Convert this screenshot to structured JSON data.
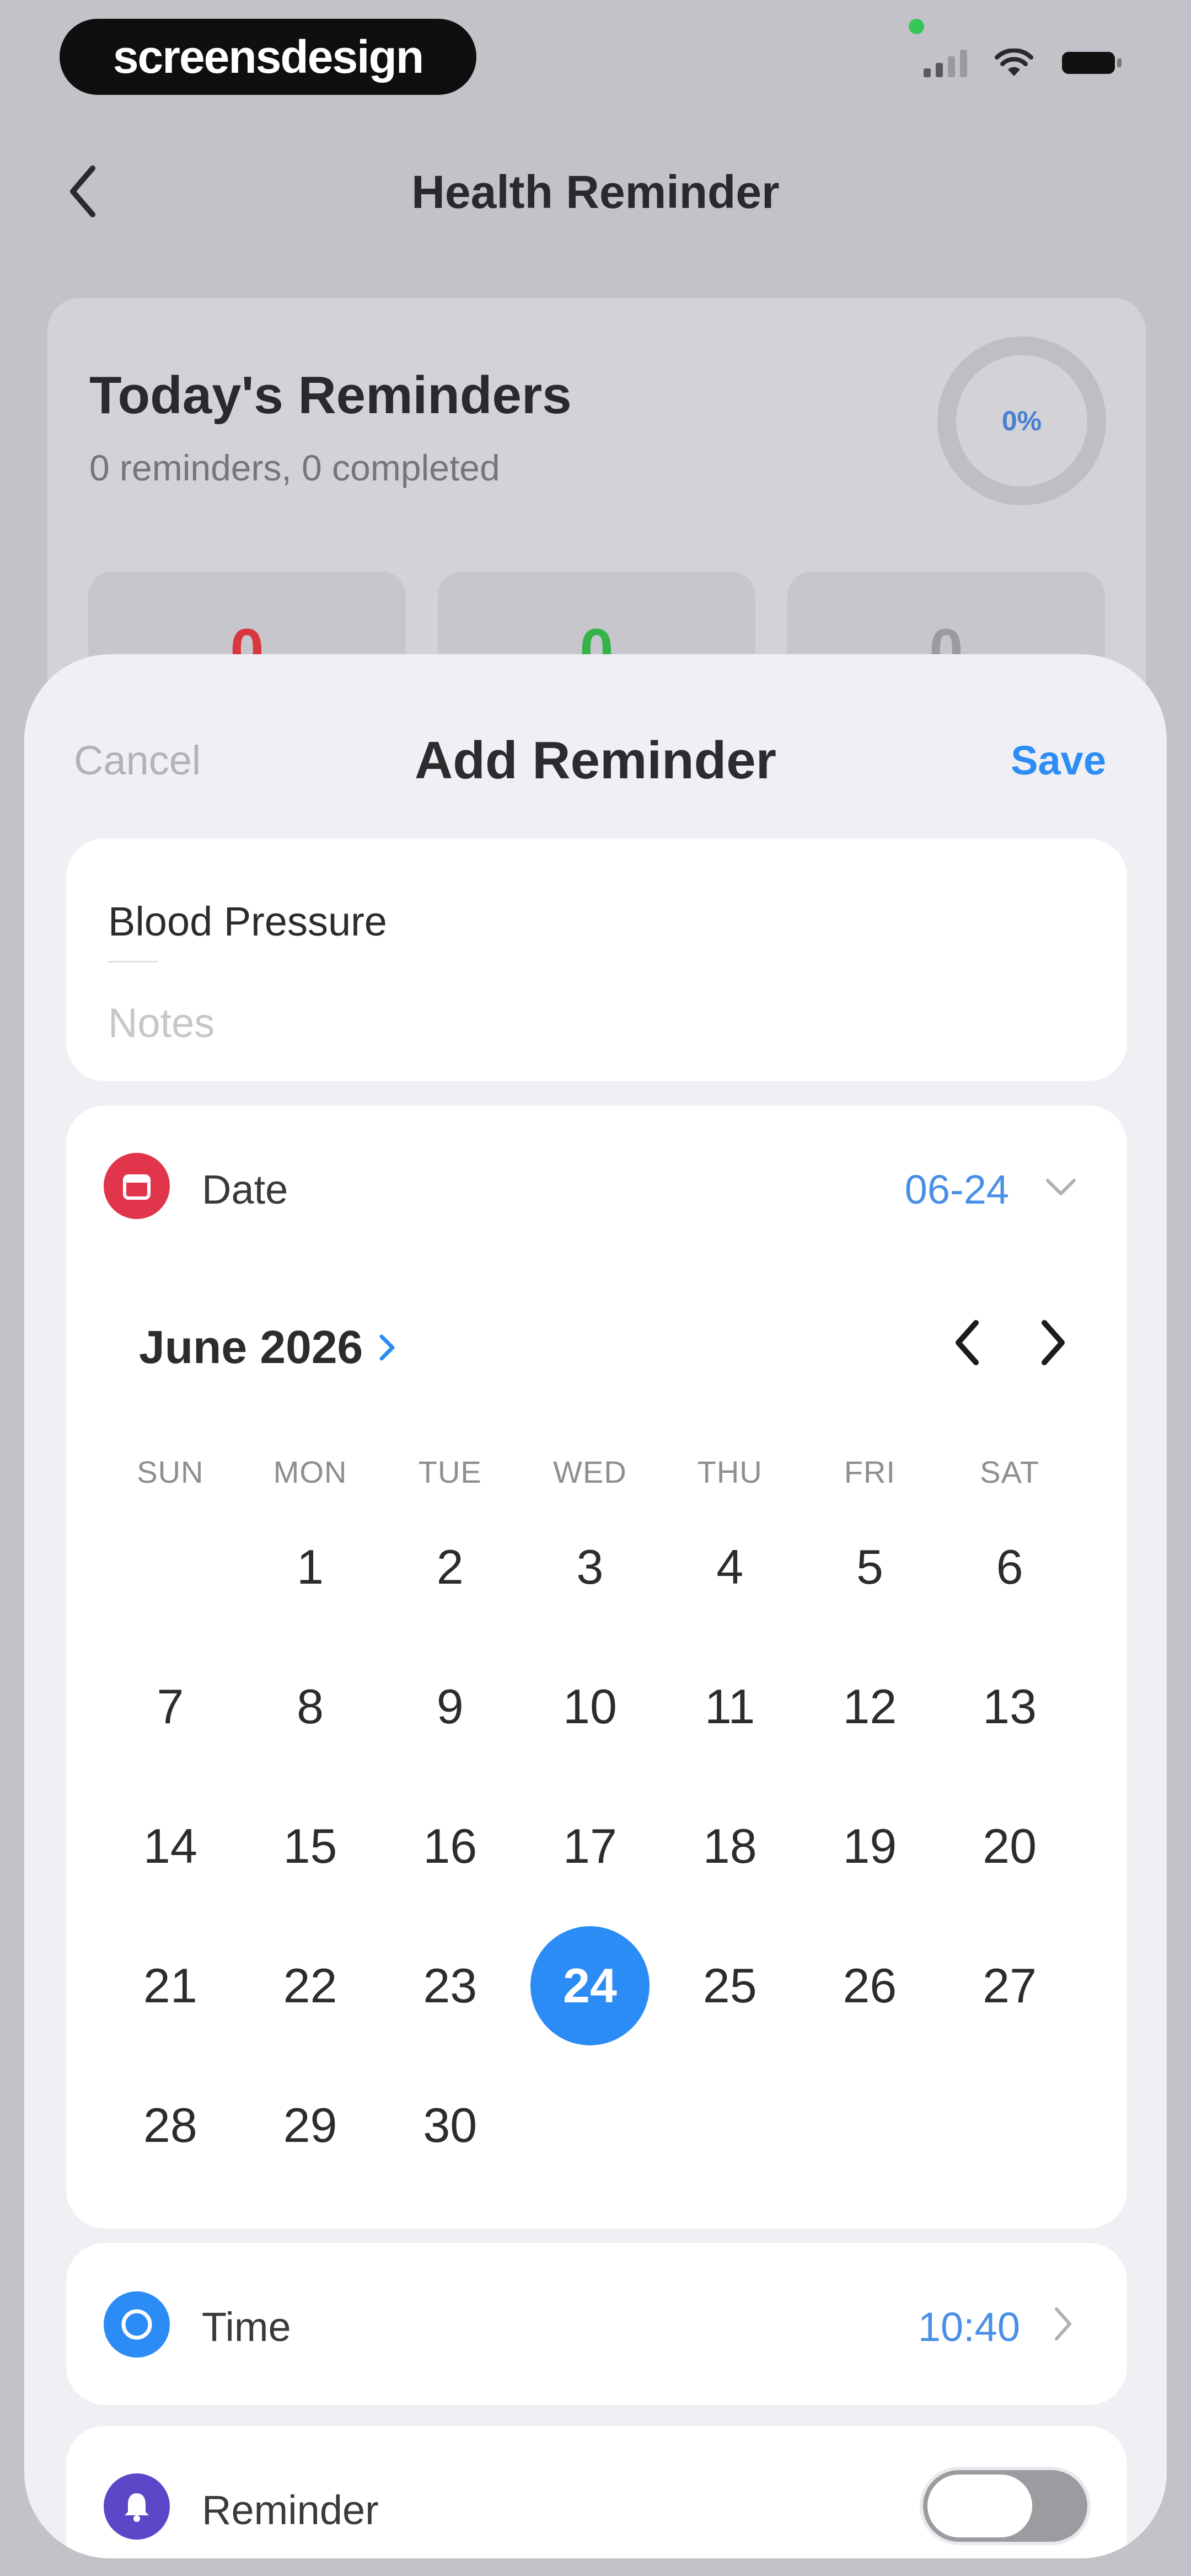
{
  "brand": "screensdesign",
  "background": {
    "header_title": "Health Reminder",
    "today": {
      "title": "Today's Reminders",
      "subtitle": "0 reminders, 0 completed",
      "progress_label": "0%",
      "progress": 0,
      "stats": [
        "0",
        "0",
        "0"
      ]
    }
  },
  "sheet": {
    "cancel_label": "Cancel",
    "title": "Add Reminder",
    "save_label": "Save",
    "name_value": "Blood Pressure",
    "notes_placeholder": "Notes",
    "date": {
      "label": "Date",
      "value": "06-24",
      "month_label": "June 2026",
      "weekdays": [
        "SUN",
        "MON",
        "TUE",
        "WED",
        "THU",
        "FRI",
        "SAT"
      ],
      "first_weekday_offset": 1,
      "days_in_month": 30,
      "selected_day": 24
    },
    "time": {
      "label": "Time",
      "value": "10:40"
    },
    "reminder": {
      "label": "Reminder",
      "enabled": false
    }
  },
  "colors": {
    "accent": "#2b8cf5",
    "date_icon": "#e0354b",
    "time_icon": "#2b8cf5",
    "reminder_icon": "#5b48c8",
    "stat_red": "#d9363e",
    "stat_green": "#35b34a",
    "stat_gray": "#9a9aa0"
  },
  "icons": {
    "back": "chevron-left-icon",
    "date": "calendar-icon",
    "time": "clock-icon",
    "reminder": "bell-icon"
  }
}
